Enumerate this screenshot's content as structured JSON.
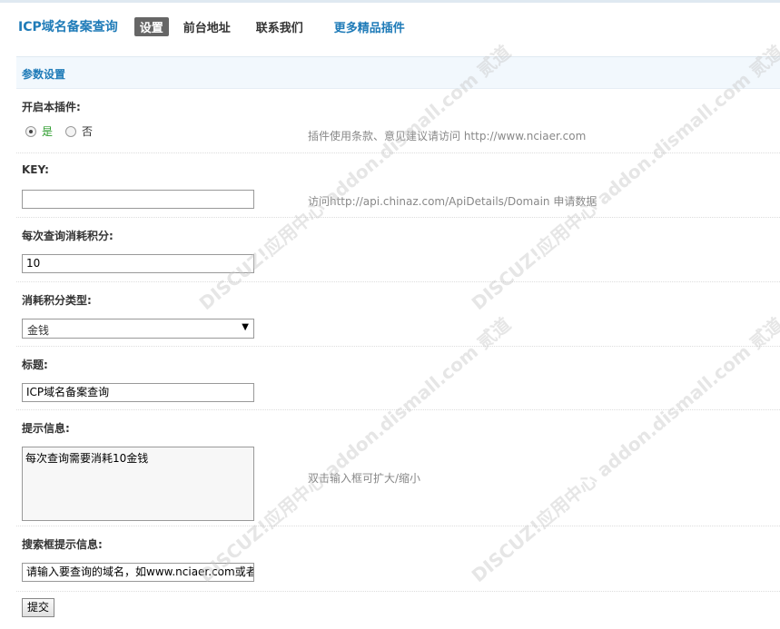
{
  "nav": {
    "title": "ICP域名备案查询",
    "tabs": [
      "设置",
      "前台地址",
      "联系我们"
    ],
    "more": "更多精品插件"
  },
  "section": {
    "title": "参数设置"
  },
  "fields": {
    "enable": {
      "label": "开启本插件:",
      "yes": "是",
      "no": "否",
      "selected": "是",
      "tip": "插件使用条款、意见建议请访问 http://www.nciaer.com"
    },
    "key": {
      "label": "KEY:",
      "value": "",
      "tip": "访问http://api.chinaz.com/ApiDetails/Domain 申请数据"
    },
    "cost": {
      "label": "每次查询消耗积分:",
      "value": "10"
    },
    "cost_type": {
      "label": "消耗积分类型:",
      "value": "金钱"
    },
    "heading": {
      "label": "标题:",
      "value": "ICP域名备案查询"
    },
    "hint": {
      "label": "提示信息:",
      "value": "每次查询需要消耗10金钱",
      "tip": "双击输入框可扩大/缩小"
    },
    "search_hint": {
      "label": "搜索框提示信息:",
      "value": "请输入要查询的域名，如www.nciaer.com或者"
    }
  },
  "submit_label": "提交",
  "watermark": "DISCUZ!应用中心 addon.dismall.com 贰道"
}
